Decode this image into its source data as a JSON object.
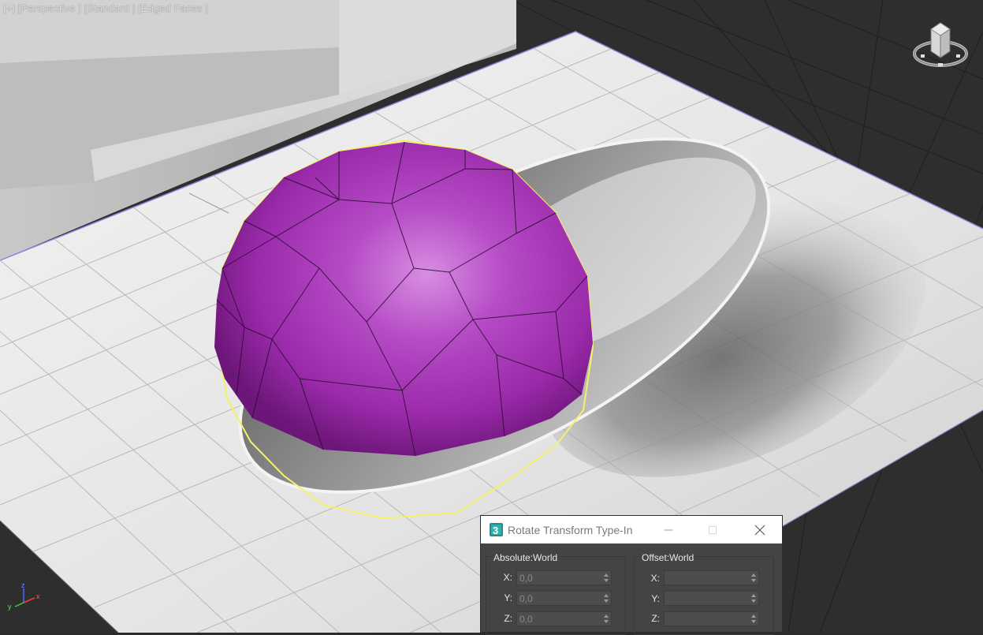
{
  "viewport": {
    "label_parts": [
      "[+]",
      "[Perspective ]",
      "[Standard ]",
      "[Edged Faces ]"
    ],
    "axis_labels": {
      "x": "x",
      "y": "y",
      "z": "z"
    }
  },
  "colors": {
    "sphere": "#a63ab8",
    "selection": "#ffff66",
    "floor": "#e8e8e8",
    "background": "#2b2b2b",
    "dialog_bg": "#444444"
  },
  "dialog": {
    "title": "Rotate Transform Type-In",
    "icon": "3ds-max-app-icon",
    "absolute": {
      "title": "Absolute:World",
      "rows": [
        {
          "label": "X:",
          "value": "0,0"
        },
        {
          "label": "Y:",
          "value": "0,0"
        },
        {
          "label": "Z:",
          "value": "0,0"
        }
      ]
    },
    "offset": {
      "title": "Offset:World",
      "rows": [
        {
          "label": "X:",
          "value": ""
        },
        {
          "label": "Y:",
          "value": ""
        },
        {
          "label": "Z:",
          "value": ""
        }
      ]
    }
  }
}
